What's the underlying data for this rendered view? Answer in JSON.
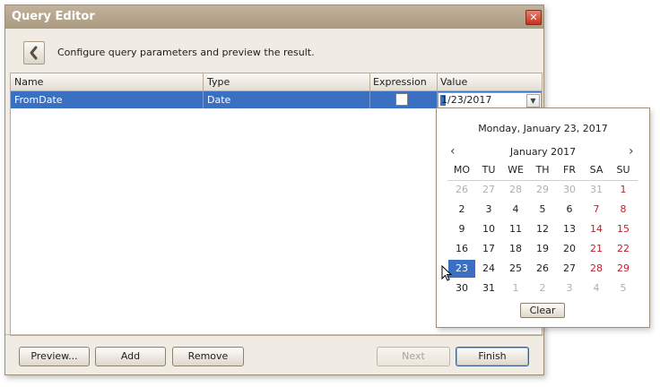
{
  "window": {
    "title": "Query Editor",
    "close_glyph": "✕"
  },
  "back_icon": "chevron-left-icon",
  "description": "Configure query parameters and preview the result.",
  "grid": {
    "headers": [
      "Name",
      "Type",
      "Expression",
      "Value"
    ],
    "row": {
      "name": "FromDate",
      "type": "Date",
      "expression_checked": false,
      "value": "1/23/2017"
    }
  },
  "buttons": {
    "preview": "Preview...",
    "add": "Add",
    "remove": "Remove",
    "next": "Next",
    "finish": "Finish"
  },
  "calendar": {
    "date_title": "Monday, January 23, 2017",
    "month_label": "January 2017",
    "prev": "‹",
    "next": "›",
    "weekdays": [
      "MO",
      "TU",
      "WE",
      "TH",
      "FR",
      "SA",
      "SU"
    ],
    "weeks": [
      [
        "26",
        "27",
        "28",
        "29",
        "30",
        "31",
        "1"
      ],
      [
        "2",
        "3",
        "4",
        "5",
        "6",
        "7",
        "8"
      ],
      [
        "9",
        "10",
        "11",
        "12",
        "13",
        "14",
        "15"
      ],
      [
        "16",
        "17",
        "18",
        "19",
        "20",
        "21",
        "22"
      ],
      [
        "23",
        "24",
        "25",
        "26",
        "27",
        "28",
        "29"
      ],
      [
        "30",
        "31",
        "1",
        "2",
        "3",
        "4",
        "5"
      ]
    ],
    "selected": "23",
    "clear_label": "Clear"
  },
  "colors": {
    "selection": "#3b6fc2",
    "weekend": "#c0202b",
    "titlebar": "#b5a48c"
  }
}
